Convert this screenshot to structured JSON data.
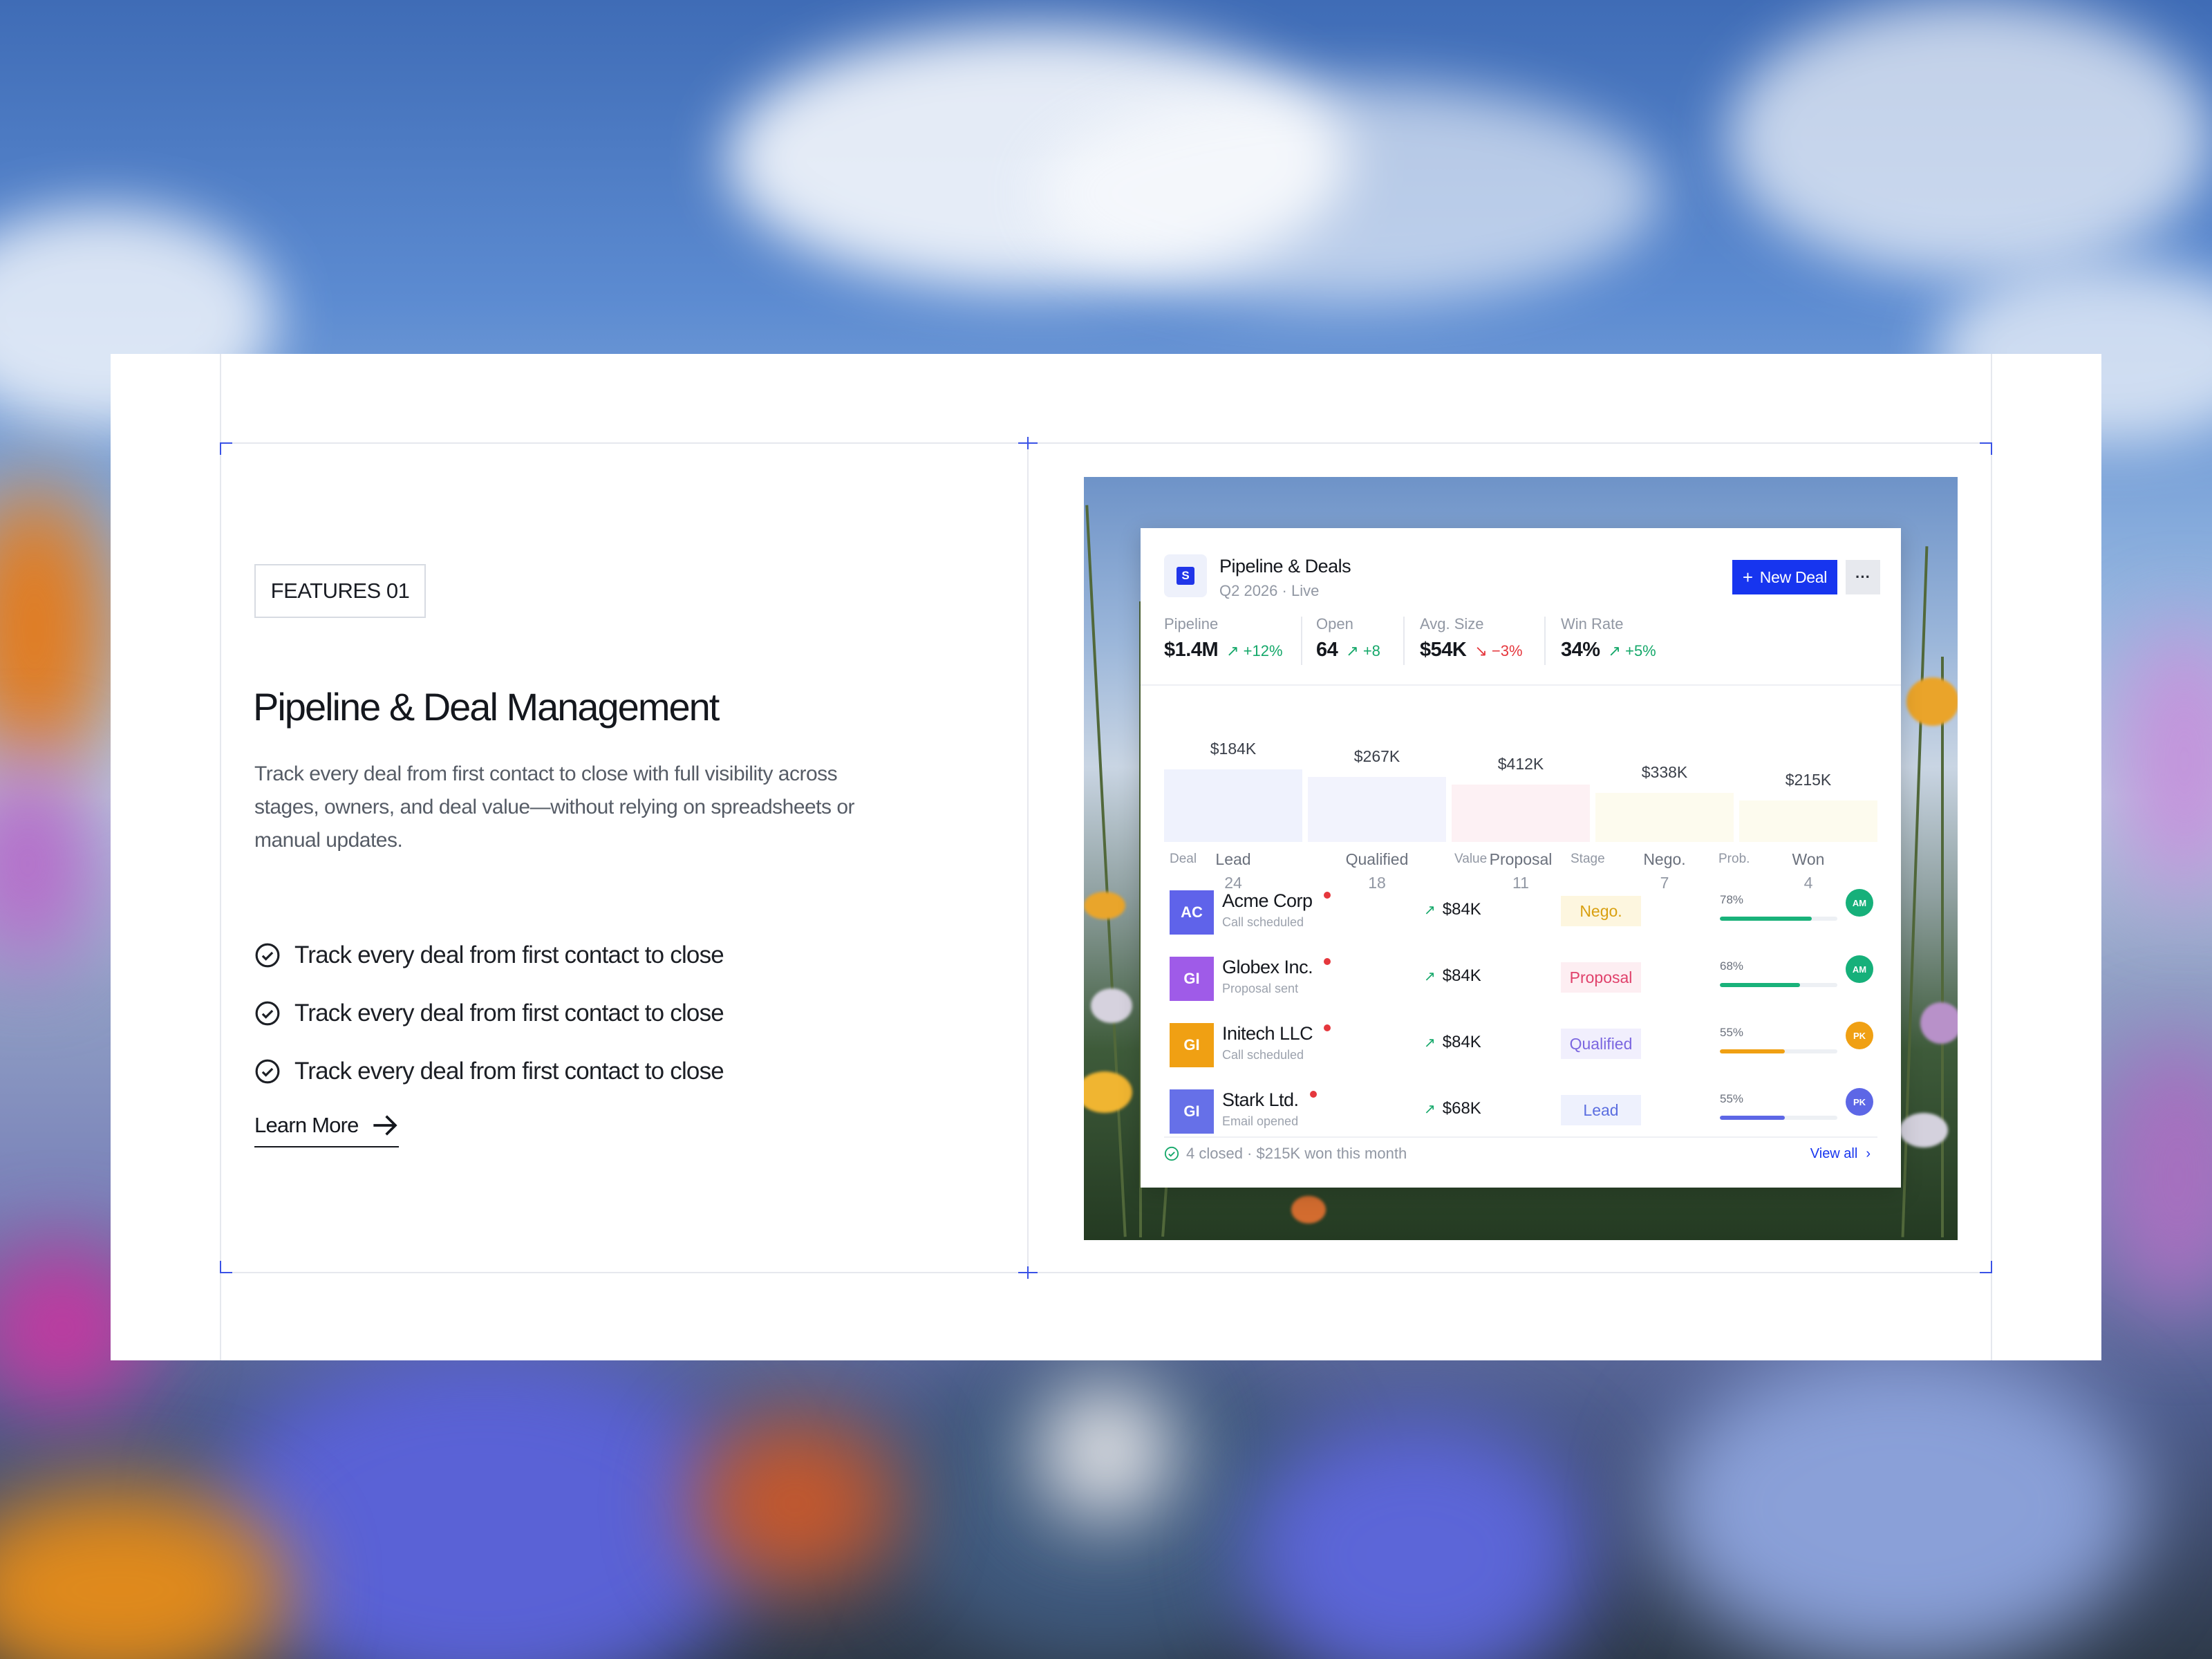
{
  "feature": {
    "badge": "FEATURES 01",
    "title": "Pipeline & Deal Management",
    "description": "Track every deal from first contact to close with full visibility across stages, owners, and deal value—without relying on spreadsheets or manual updates.",
    "checklist": [
      "Track every deal from first contact to close",
      "Track every deal from first contact to close",
      "Track every deal from first contact to close"
    ],
    "cta": "Learn More"
  },
  "dashboard": {
    "logo_letter": "S",
    "title": "Pipeline & Deals",
    "subtitle": "Q2 2026 · Live",
    "new_deal_label": "New Deal",
    "more_label": "···",
    "kpis": [
      {
        "label": "Pipeline",
        "value": "$1.4M",
        "delta": "+12%",
        "trend": "up"
      },
      {
        "label": "Open",
        "value": "64",
        "delta": "+8",
        "trend": "up"
      },
      {
        "label": "Avg. Size",
        "value": "$54K",
        "delta": "−3%",
        "trend": "down"
      },
      {
        "label": "Win Rate",
        "value": "34%",
        "delta": "+5%",
        "trend": "up"
      }
    ],
    "colors": {
      "accent": "#1735ef",
      "positive": "#15a86a",
      "negative": "#e5373d"
    },
    "chart_data": {
      "type": "bar",
      "categories": [
        "Lead",
        "Qualified",
        "Proposal",
        "Nego.",
        "Won"
      ],
      "values": [
        184,
        267,
        412,
        338,
        215
      ],
      "value_labels": [
        "$184K",
        "$267K",
        "$412K",
        "$338K",
        "$215K"
      ],
      "counts": [
        "24",
        "18",
        "11",
        "7",
        "4"
      ],
      "count_values": [
        24,
        18,
        11,
        7,
        4
      ],
      "bar_colors": [
        "#eff2fd",
        "#f2f3fd",
        "#fdf1f4",
        "#fdfbee",
        "#fdfbee"
      ],
      "grid": false,
      "legend": "none"
    },
    "table": {
      "headers": {
        "deal": "Deal",
        "value": "Value",
        "stage": "Stage",
        "prob": "Prob."
      },
      "rows": [
        {
          "initials": "AC",
          "avatar_color": "#5f63ea",
          "name": "Acme Corp",
          "note": "Call scheduled",
          "value": "$84K",
          "stage": "Nego.",
          "stage_color": "#d9a010",
          "stage_bg": "#fdf6df",
          "prob_label": "78%",
          "prob": 78,
          "prob_color": "#19b27a",
          "owner": "AM",
          "owner_color": "#16b07a"
        },
        {
          "initials": "GI",
          "avatar_color": "#9f5be8",
          "name": "Globex Inc.",
          "note": "Proposal sent",
          "value": "$84K",
          "stage": "Proposal",
          "stage_color": "#e0416b",
          "stage_bg": "#fdeef2",
          "prob_label": "68%",
          "prob": 68,
          "prob_color": "#19b27a",
          "owner": "AM",
          "owner_color": "#16b07a"
        },
        {
          "initials": "GI",
          "avatar_color": "#f0a013",
          "name": "Initech LLC",
          "note": "Call scheduled",
          "value": "$84K",
          "stage": "Qualified",
          "stage_color": "#7b66e0",
          "stage_bg": "#f1effd",
          "prob_label": "55%",
          "prob": 55,
          "prob_color": "#f0a013",
          "owner": "PK",
          "owner_color": "#f0a013"
        },
        {
          "initials": "GI",
          "avatar_color": "#6670e8",
          "name": "Stark Ltd.",
          "note": "Email opened",
          "value": "$68K",
          "stage": "Lead",
          "stage_color": "#5b6ee0",
          "stage_bg": "#eef1fd",
          "prob_label": "55%",
          "prob": 55,
          "prob_color": "#5d67e6",
          "owner": "PK",
          "owner_color": "#5d67e6"
        }
      ]
    },
    "footer": "4 closed · $215K won this month",
    "view_all": "View all"
  }
}
